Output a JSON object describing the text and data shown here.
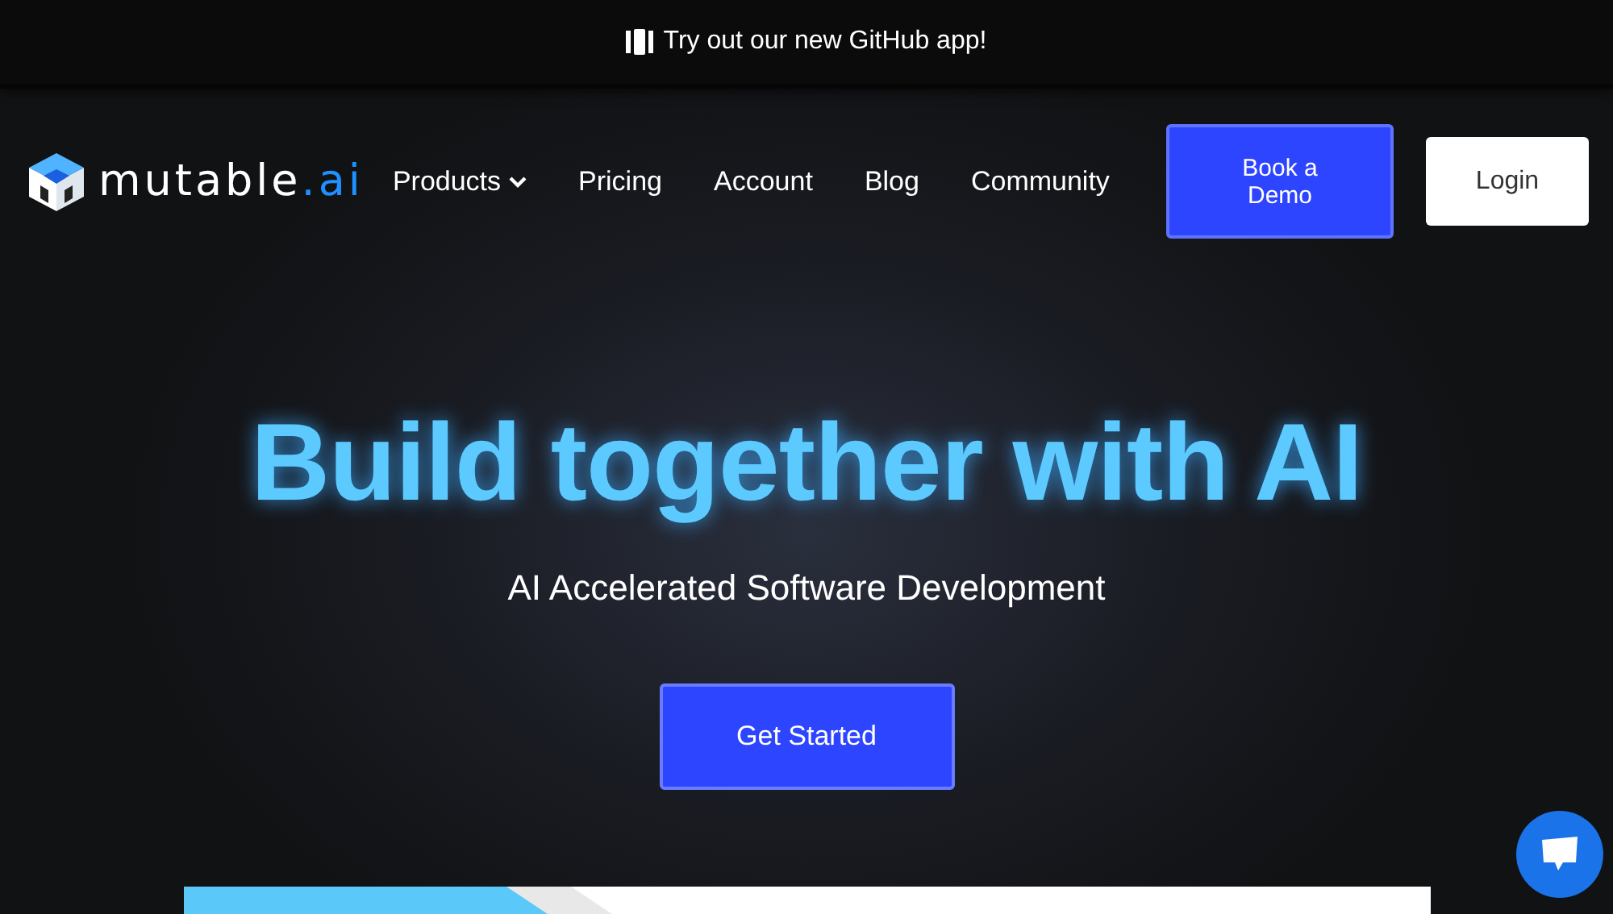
{
  "banner": {
    "text": "Try out our new GitHub app!"
  },
  "nav": {
    "logo": {
      "name": "mutable",
      "suffix": ".ai"
    },
    "links": [
      {
        "label": "Products",
        "kind": "dropdown"
      },
      {
        "label": "Pricing",
        "kind": "link"
      },
      {
        "label": "Account",
        "kind": "link"
      },
      {
        "label": "Blog",
        "kind": "link"
      },
      {
        "label": "Community",
        "kind": "link"
      }
    ],
    "demo_button": "Book a Demo",
    "login_button": "Login"
  },
  "hero": {
    "title": "Build together with AI",
    "subtitle": "AI Accelerated Software Development",
    "cta": "Get Started"
  }
}
